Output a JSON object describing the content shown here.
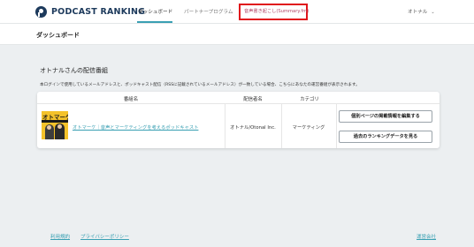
{
  "header": {
    "logo_text": "PODCAST RANKING",
    "nav": {
      "dashboard": "ダッシュボード",
      "partner_program": "パートナープログラム",
      "summary": "音声書き起こし(Summary.fm)"
    },
    "user_menu": "オトナル"
  },
  "page": {
    "title": "ダッシュボード"
  },
  "programs": {
    "section_title": "オトナルさんの配信番組",
    "notice": "本ログインで使用しているメールアドレスと、ポッドキャスト配信（RSSに記載されているメールアドレス）が一致している場合、こちらにあなたの運営番組が表示されます。",
    "columns": {
      "program": "番組名",
      "host": "配信者名",
      "category": "カテゴリ"
    },
    "rows": [
      {
        "thumbnail_title": "オトマーケ",
        "program_name": "オトマーケ｜音声とマーケティングを考えるポッドキャスト",
        "host": "オトナル/Otonal Inc.",
        "category": "マーケティング",
        "edit_button": "個別ページの掲載情報を編集する",
        "history_button": "過去のランキングデータを見る"
      }
    ]
  },
  "footer": {
    "terms": "利用規約",
    "privacy": "プライバシーポリシー",
    "company": "運営会社"
  },
  "colors": {
    "accent": "#3aa0b3",
    "brand": "#1d3a5c",
    "highlight_box": "#e0151c",
    "thumbnail_bg": "#f4c22a"
  }
}
